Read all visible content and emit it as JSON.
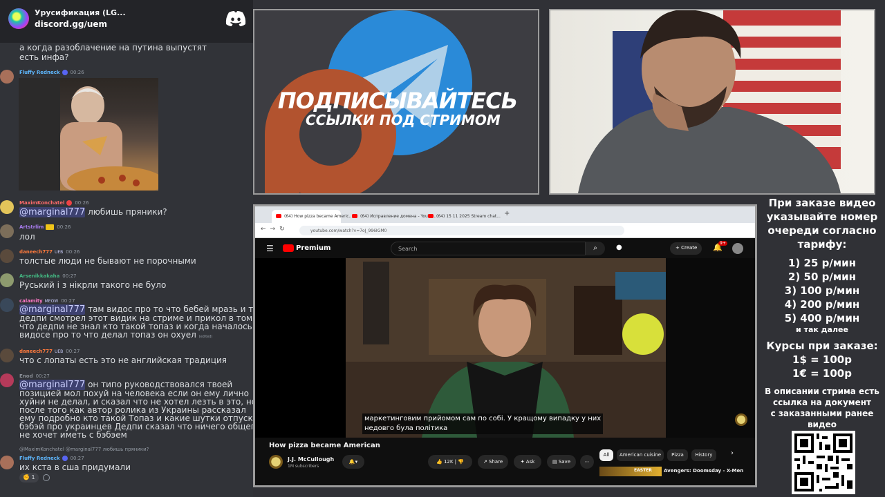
{
  "discord": {
    "server_name": "Урусификация (LG...",
    "invite": "discord.gg/uem",
    "messages": [
      {
        "text_lines": [
          "а когда разоблачение на путина выпустят",
          "есть инфа?"
        ]
      },
      {
        "user": "Fluffy Redneck",
        "user_color": "#5eb8ff",
        "time": "00:26",
        "has_image": true
      },
      {
        "user": "MaximKonchatel",
        "user_color": "#ff6b6b",
        "time": "00:26",
        "mention": "@marginal777",
        "text": "любишь пряники?"
      },
      {
        "user": "Artstrlim",
        "user_color": "#a97cf0",
        "time": "00:26",
        "text": "лол"
      },
      {
        "user": "daneech777",
        "user_color": "#ff7a3d",
        "badge": "UEB",
        "time": "00:26",
        "text": "толстые люди не бывают не порочными"
      },
      {
        "user": "Arsenikkakaha",
        "user_color": "#43b581",
        "time": "00:27",
        "text": "Руський і з нікрли такого не було"
      },
      {
        "user": "calamity",
        "user_color": "#ff78c8",
        "badge": "MEOW",
        "time": "00:27",
        "mention": "@marginal777",
        "text_first": "там видос про то что бебей мразь и тд,",
        "text_lines": [
          "дедпи смотрел этот видик на стриме и прикол в том",
          "что дедпи не знал кто такой топаз и когда началось в",
          "видосе про то что делал топаз он охуел"
        ],
        "edited": "(edited)"
      },
      {
        "user": "daneech777",
        "user_color": "#ff7a3d",
        "badge": "UEB",
        "time": "00:27",
        "text": "что с лопаты есть это не английская традиция"
      },
      {
        "user": "Enod",
        "user_color": "#8a8f97",
        "time": "00:27",
        "mention": "@marginal777",
        "text_first": "он типо руководствовался твоей",
        "text_lines": [
          "позицией мол похуй на человека если он ему лично",
          "хуйни не делал, и сказал что не хотел лезть в это, но",
          "после того как автор ролика из Украины рассказал",
          "ему подробно кто такой Топаз и какие шутки отпускал",
          "бэбэй про украинцев Дедпи сказал что ничего общего",
          "не хочет иметь с бэбэем"
        ]
      },
      {
        "reply": "@MaximKonchatel @marginal777 любишь пряники?",
        "user": "Fluffy Redneck",
        "user_color": "#5eb8ff",
        "time": "00:27",
        "text": "их кста в сша придумали",
        "reaction_count": "1"
      }
    ]
  },
  "promo": {
    "title": "ПОДПИСЫВАЙТЕСЬ",
    "subtitle": "ССЫЛКИ ПОД СТРИМОМ"
  },
  "browser": {
    "tabs": [
      "(64) How pizza became Americ...",
      "(64) Исправление домена - YouTu...",
      "(64) 15 11 2025 Stream chat..."
    ],
    "url": "youtube.com/watch?v=7oJ_996IGM0",
    "youtube": {
      "logo_text": "Premium",
      "search_placeholder": "Search",
      "create_label": "Create",
      "notification_count": "9+",
      "caption_lines": [
        "маркетинговим прийомом сам по собі. У кращому випадку у них",
        "недовго була політика"
      ],
      "video_title": "How pizza became American",
      "channel_name": "J.J. McCullough",
      "subscribers": "1M subscribers",
      "likes": "12K",
      "share_label": "Share",
      "ask_label": "Ask",
      "save_label": "Save",
      "chips": [
        "All",
        "American cuisine",
        "Pizza",
        "History"
      ],
      "rec_title": "Avengers: Doomsday - X-Men",
      "rec_thumb_text": "EASTER"
    }
  },
  "prices": {
    "intro": [
      "При заказе видео",
      "указывайте номер",
      "очереди согласно",
      "тарифу:"
    ],
    "tiers": [
      "1) 25 р/мин",
      "2) 50 р/мин",
      "3) 100 р/мин",
      "4) 200 р/мин",
      "5) 400 р/мин"
    ],
    "etc": "и так далее",
    "rates_title": "Курсы при заказе:",
    "rates": [
      "1$ = 100р",
      "1€ = 100р"
    ],
    "footer": [
      "В описании стрима есть",
      "ссылка на документ",
      "с заказанными ранее",
      "видео"
    ]
  }
}
